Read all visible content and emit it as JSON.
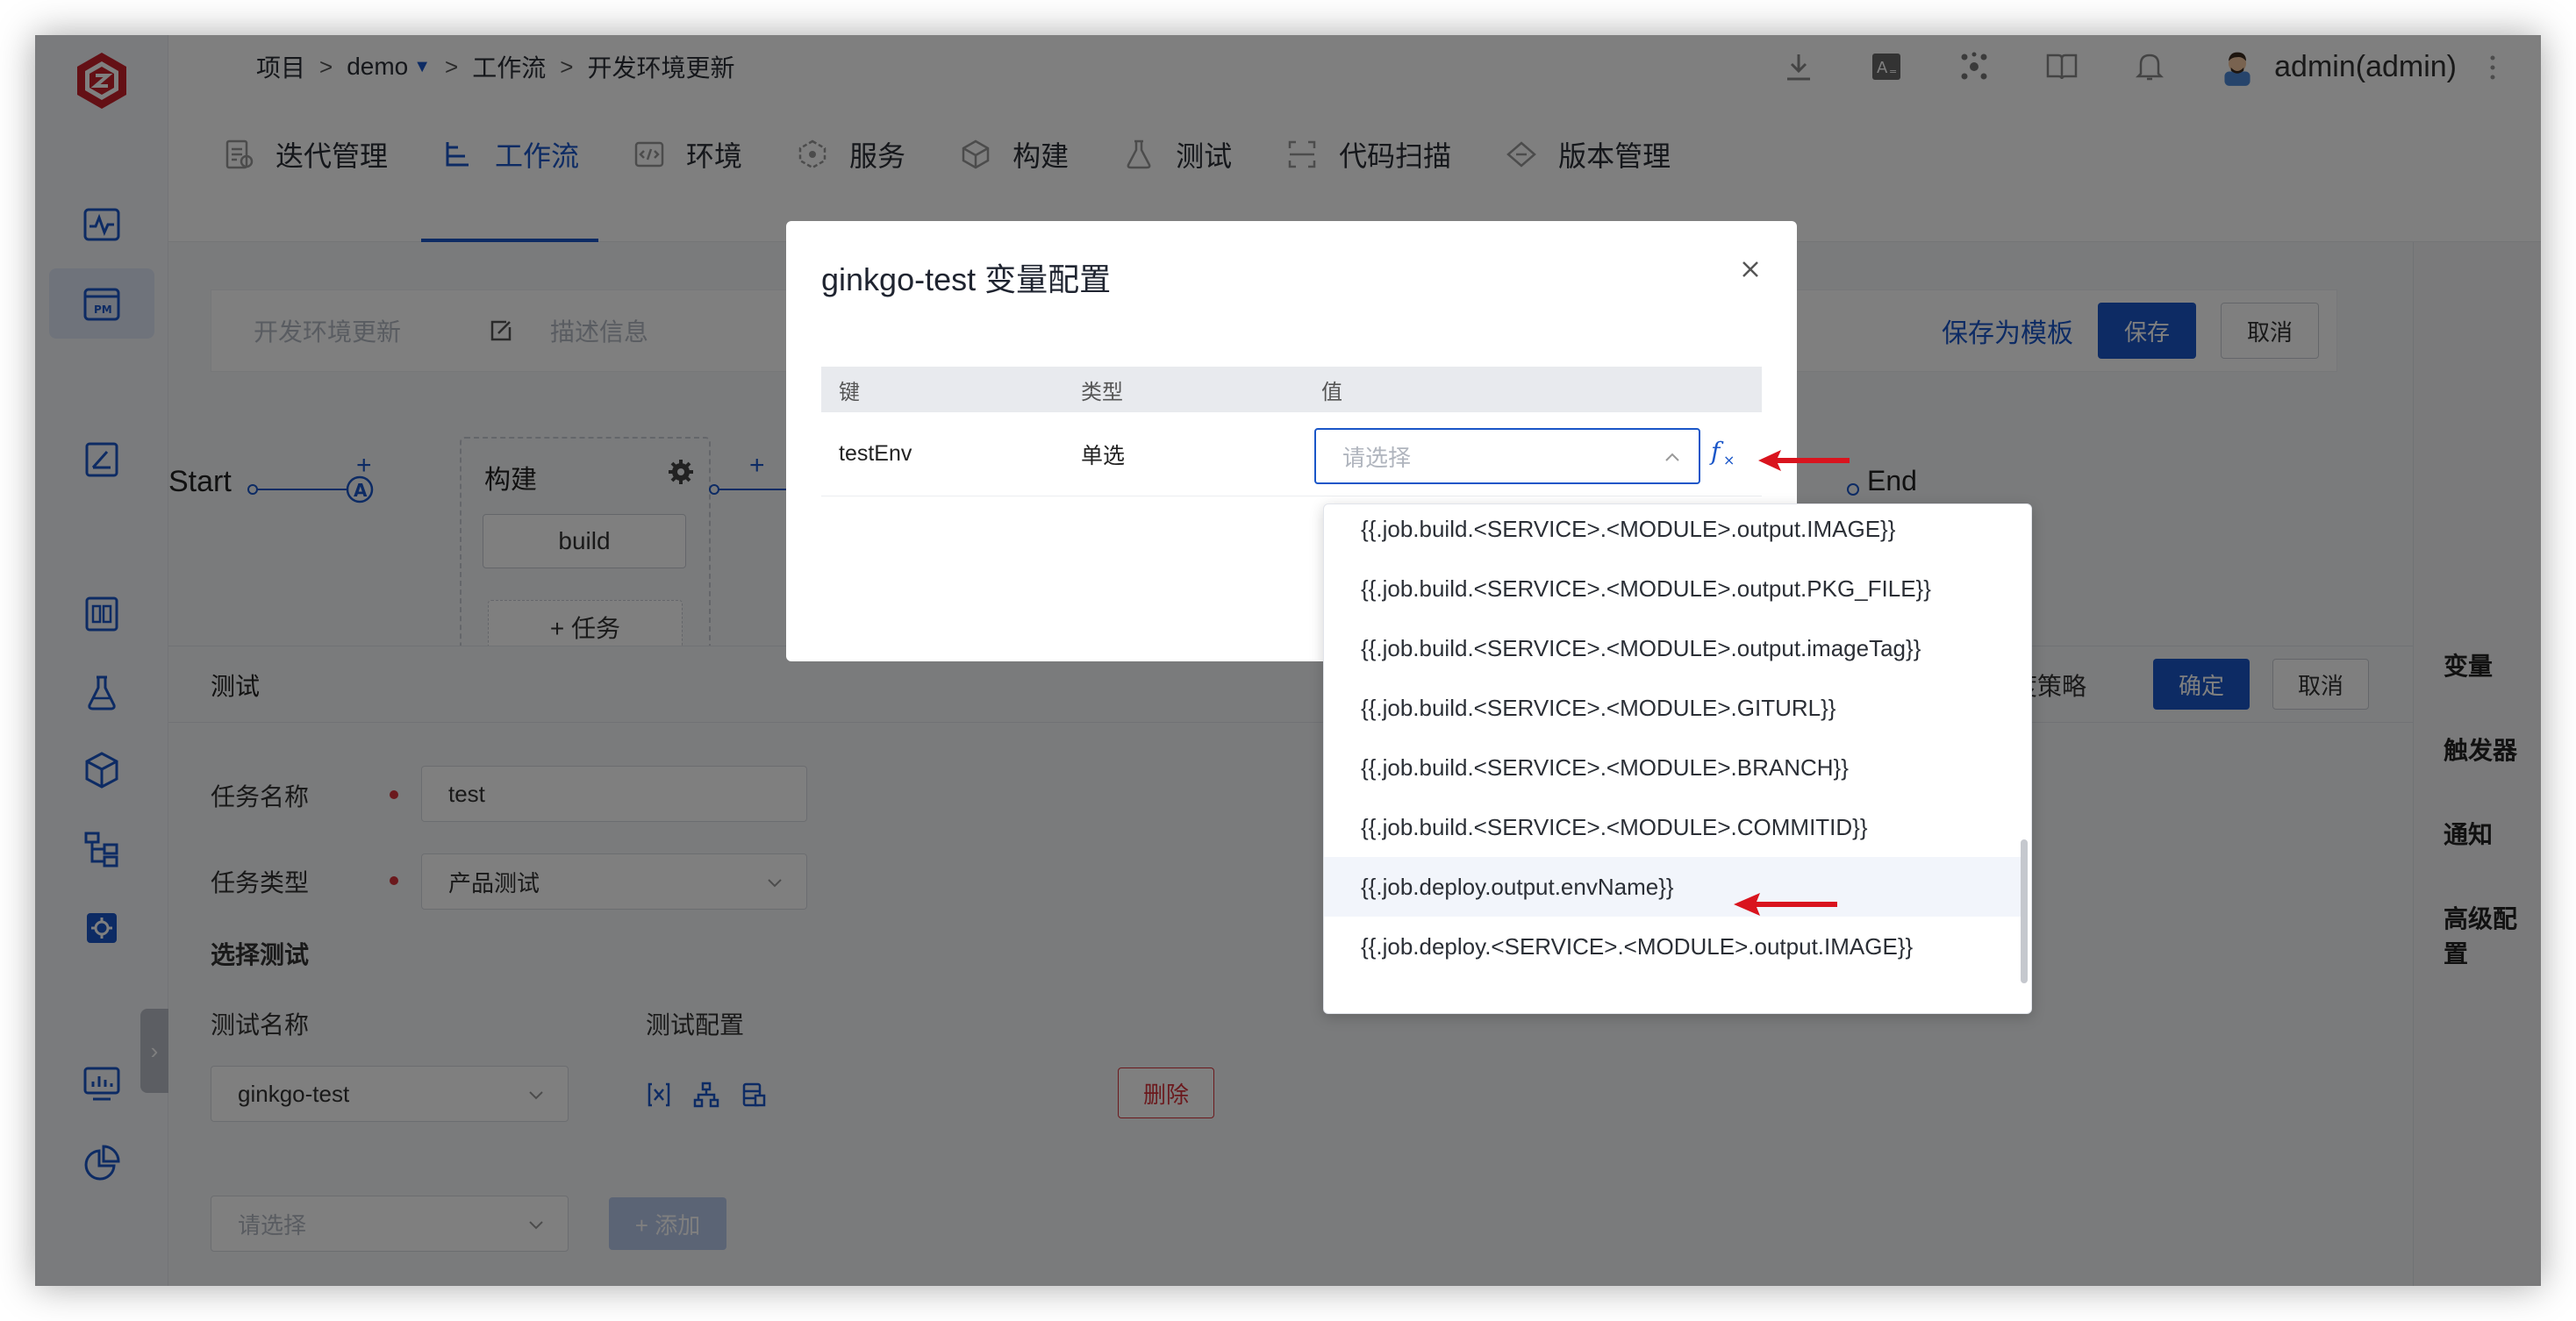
{
  "breadcrumb": {
    "root": "项目",
    "sep": ">",
    "project": "demo",
    "section": "工作流",
    "page": "开发环境更新"
  },
  "user": {
    "name": "admin(admin)"
  },
  "nav_tabs": [
    {
      "label": "迭代管理",
      "icon": "iteration-icon"
    },
    {
      "label": "工作流",
      "icon": "workflow-icon",
      "active": true
    },
    {
      "label": "环境",
      "icon": "environment-icon"
    },
    {
      "label": "服务",
      "icon": "service-icon"
    },
    {
      "label": "构建",
      "icon": "build-icon"
    },
    {
      "label": "测试",
      "icon": "test-icon"
    },
    {
      "label": "代码扫描",
      "icon": "code-scan-icon"
    },
    {
      "label": "版本管理",
      "icon": "version-icon"
    }
  ],
  "editor": {
    "workflow_name": "开发环境更新",
    "description_placeholder": "描述信息",
    "save_template": "保存为模板",
    "save": "保存",
    "cancel": "取消"
  },
  "workflow": {
    "start": "Start",
    "end": "End",
    "plus": "+",
    "stage_label": "构建",
    "job_label": "build",
    "add_task": "+ 任务",
    "node_badge": "A"
  },
  "side_settings": [
    "变量",
    "触发器",
    "通知",
    "高级配置"
  ],
  "test_panel": {
    "title": "测试",
    "strategy": "调度策略",
    "confirm": "确定",
    "cancel": "取消",
    "task_name_label": "任务名称",
    "task_name_value": "test",
    "task_type_label": "任务类型",
    "task_type_value": "产品测试",
    "select_test_label": "选择测试",
    "test_name_col": "测试名称",
    "test_config_col": "测试配置",
    "test_name_value": "ginkgo-test",
    "delete": "删除",
    "select_placeholder": "请选择",
    "add": "+ 添加"
  },
  "modal": {
    "title": "ginkgo-test 变量配置",
    "columns": [
      "键",
      "类型",
      "值"
    ],
    "row": {
      "key": "testEnv",
      "type": "单选",
      "value_placeholder": "请选择"
    }
  },
  "dropdown_options": [
    "{{.job.build.<SERVICE>.<MODULE>.output.IMAGE}}",
    "{{.job.build.<SERVICE>.<MODULE>.output.PKG_FILE}}",
    "{{.job.build.<SERVICE>.<MODULE>.output.imageTag}}",
    "{{.job.build.<SERVICE>.<MODULE>.GITURL}}",
    "{{.job.build.<SERVICE>.<MODULE>.BRANCH}}",
    "{{.job.build.<SERVICE>.<MODULE>.COMMITID}}",
    "{{.job.deploy.output.envName}}",
    "{{.job.deploy.<SERVICE>.<MODULE>.output.IMAGE}}"
  ],
  "colors": {
    "primary": "#1a56c8",
    "brand": "#c8202a",
    "annotation": "#d9141e"
  }
}
